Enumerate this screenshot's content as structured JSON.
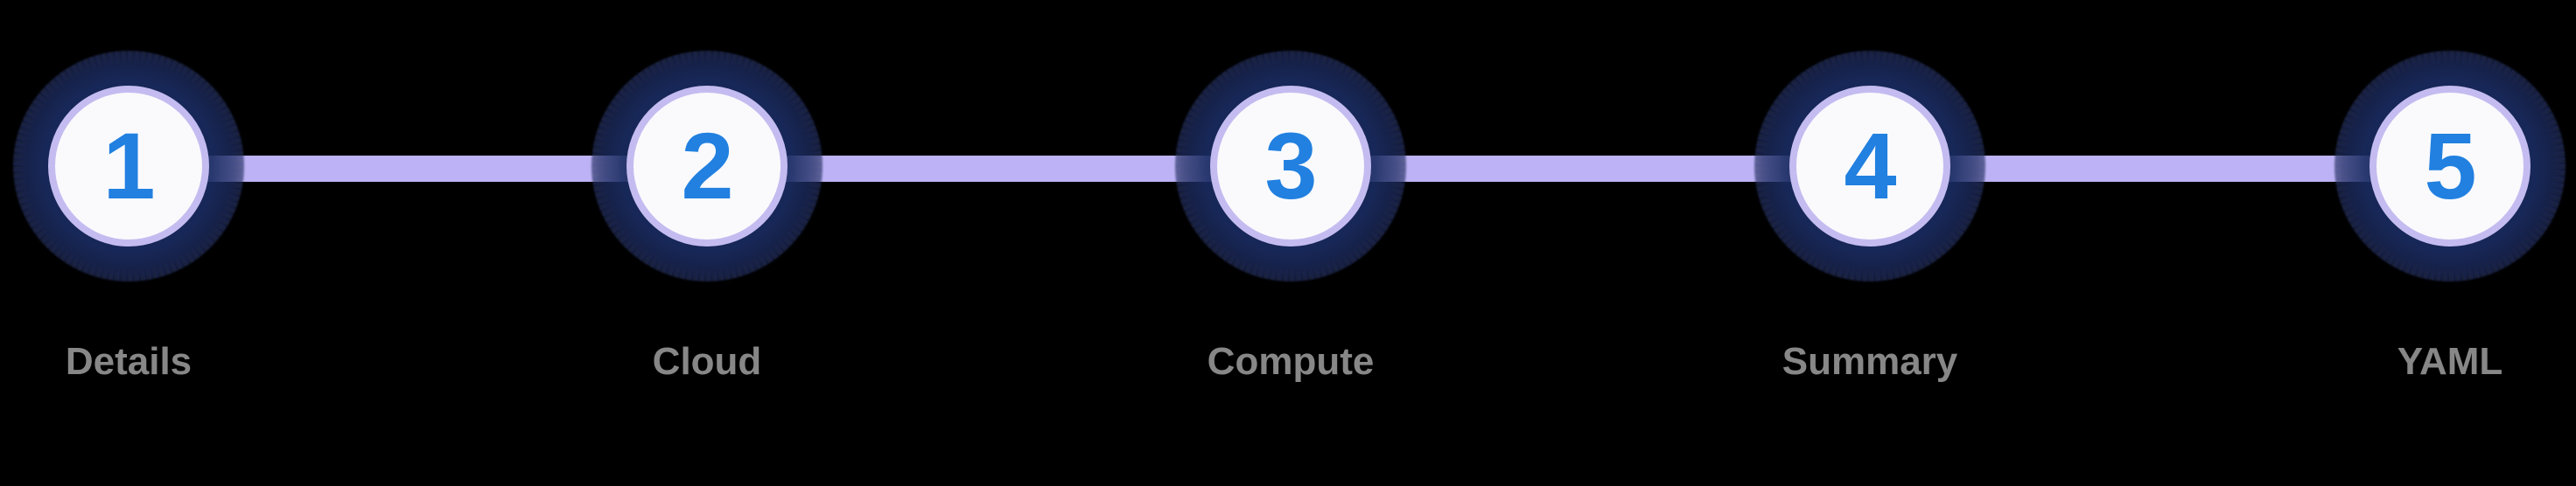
{
  "component": {
    "name": "Wizard progress stepper",
    "background_color": "#000000",
    "connector_color": "#bdb2f5",
    "circle_fill_color": "#fafafd",
    "circle_border_color": "#c4bcf0",
    "number_color": "#2180e0",
    "label_color": "#878787",
    "halo_color": "#16255a"
  },
  "steps": [
    {
      "number": "1",
      "label": "Details"
    },
    {
      "number": "2",
      "label": "Cloud"
    },
    {
      "number": "3",
      "label": "Compute"
    },
    {
      "number": "4",
      "label": "Summary"
    },
    {
      "number": "5",
      "label": "YAML"
    }
  ]
}
